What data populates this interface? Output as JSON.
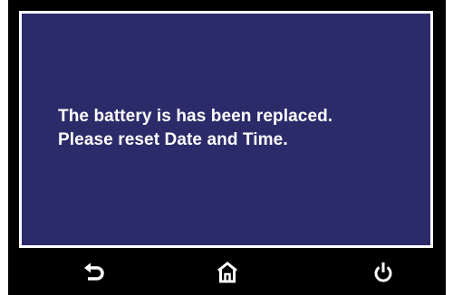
{
  "dialog": {
    "line1": "The battery is has been replaced.",
    "line2": "Please reset Date and Time."
  },
  "nav": {
    "buttons": [
      {
        "icon": "back-arrow-icon"
      },
      {
        "icon": "home-icon"
      },
      {
        "icon": "power-icon"
      }
    ]
  },
  "colors": {
    "screen_background": "#2c2b6a",
    "bezel": "#000000",
    "text": "#ffffff"
  }
}
